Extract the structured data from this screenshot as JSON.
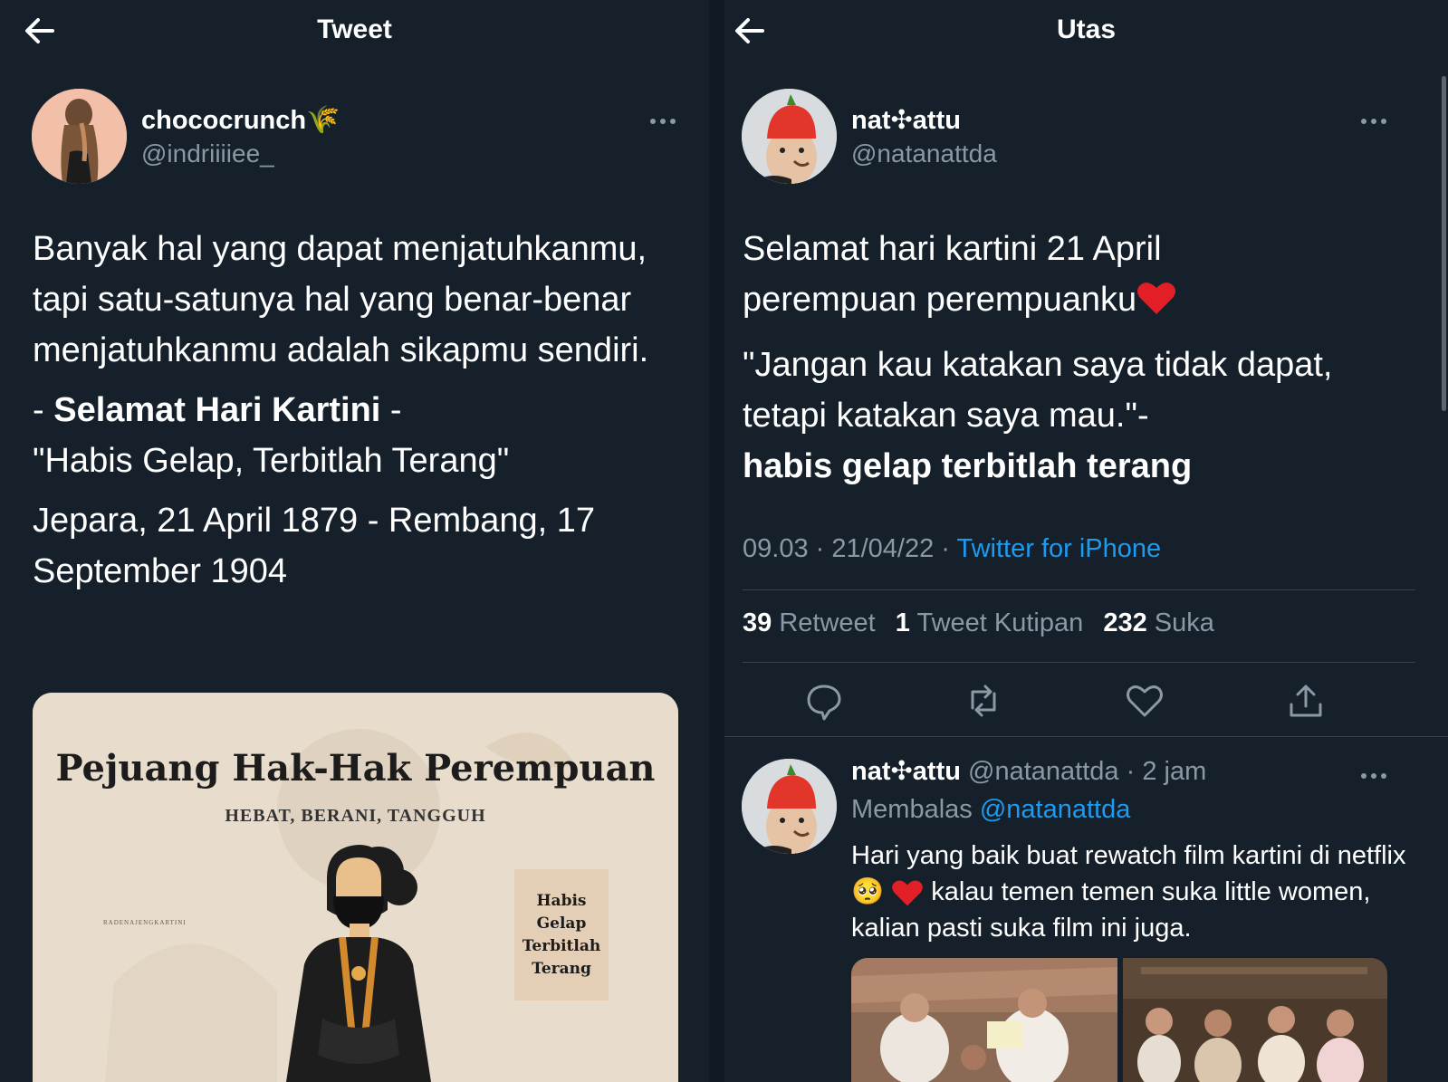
{
  "left": {
    "header": {
      "title": "Tweet"
    },
    "author": {
      "name": "chococrunch",
      "name_emoji": "🌾",
      "handle": "@indriiiiee_"
    },
    "tweet": {
      "paragraph1": "Banyak hal yang dapat menjatuhkanmu, tapi satu-satunya hal yang benar-benar menjatuhkanmu adalah sikapmu sendiri.",
      "line2_prefix": "- ",
      "line2_bold": "Selamat Hari Kartini",
      "line2_suffix": " -",
      "line3": "\"Habis Gelap, Terbitlah Terang\"",
      "paragraph4": "Jepara, 21 April 1879 - Rembang, 17 September 1904"
    },
    "poster": {
      "title": "Pejuang Hak-Hak Perempuan",
      "subtitle": "HEBAT, BERANI, TANGGUH",
      "side_small": "RADENAJENGKARTINI",
      "card_lines": [
        "Habis",
        "Gelap",
        "Terbitlah",
        "Terang"
      ]
    }
  },
  "right": {
    "header": {
      "title": "Utas"
    },
    "author": {
      "name": "nat✣attu",
      "handle": "@natanattda"
    },
    "tweet": {
      "line1": "Selamat hari kartini 21 April",
      "line2": "perempuan perempuanku",
      "quote": "\"Jangan kau katakan saya tidak dapat, tetapi katakan saya mau.\"-",
      "bold_line": "habis gelap terbitlah terang"
    },
    "meta": {
      "time": "09.03",
      "date": "21/04/22",
      "source": "Twitter for iPhone"
    },
    "stats": {
      "retweets": "39",
      "retweets_label": "Retweet",
      "quotes": "1",
      "quotes_label": "Tweet Kutipan",
      "likes": "232",
      "likes_label": "Suka"
    },
    "reply": {
      "name": "nat✣attu",
      "handle": "@natanattda",
      "time": "2 jam",
      "replying_label": "Membalas",
      "replying_to": "@natanattda",
      "text_part1": "Hari yang baik buat rewatch film kartini di netflix",
      "text_emoji": "🥺",
      "text_part2": "kalau temen temen suka little women, kalian pasti suka film ini juga."
    }
  },
  "icons": {
    "back": "arrow-left-icon",
    "more": "more-horizontal-icon",
    "reply": "speech-bubble-icon",
    "retweet": "retweet-icon",
    "like": "heart-icon",
    "share": "share-upload-icon",
    "heart_emoji": "red-heart-emoji"
  },
  "colors": {
    "background": "#15202b",
    "link": "#1d9bf0",
    "muted": "#8b98a5",
    "separator": "#38444d"
  }
}
